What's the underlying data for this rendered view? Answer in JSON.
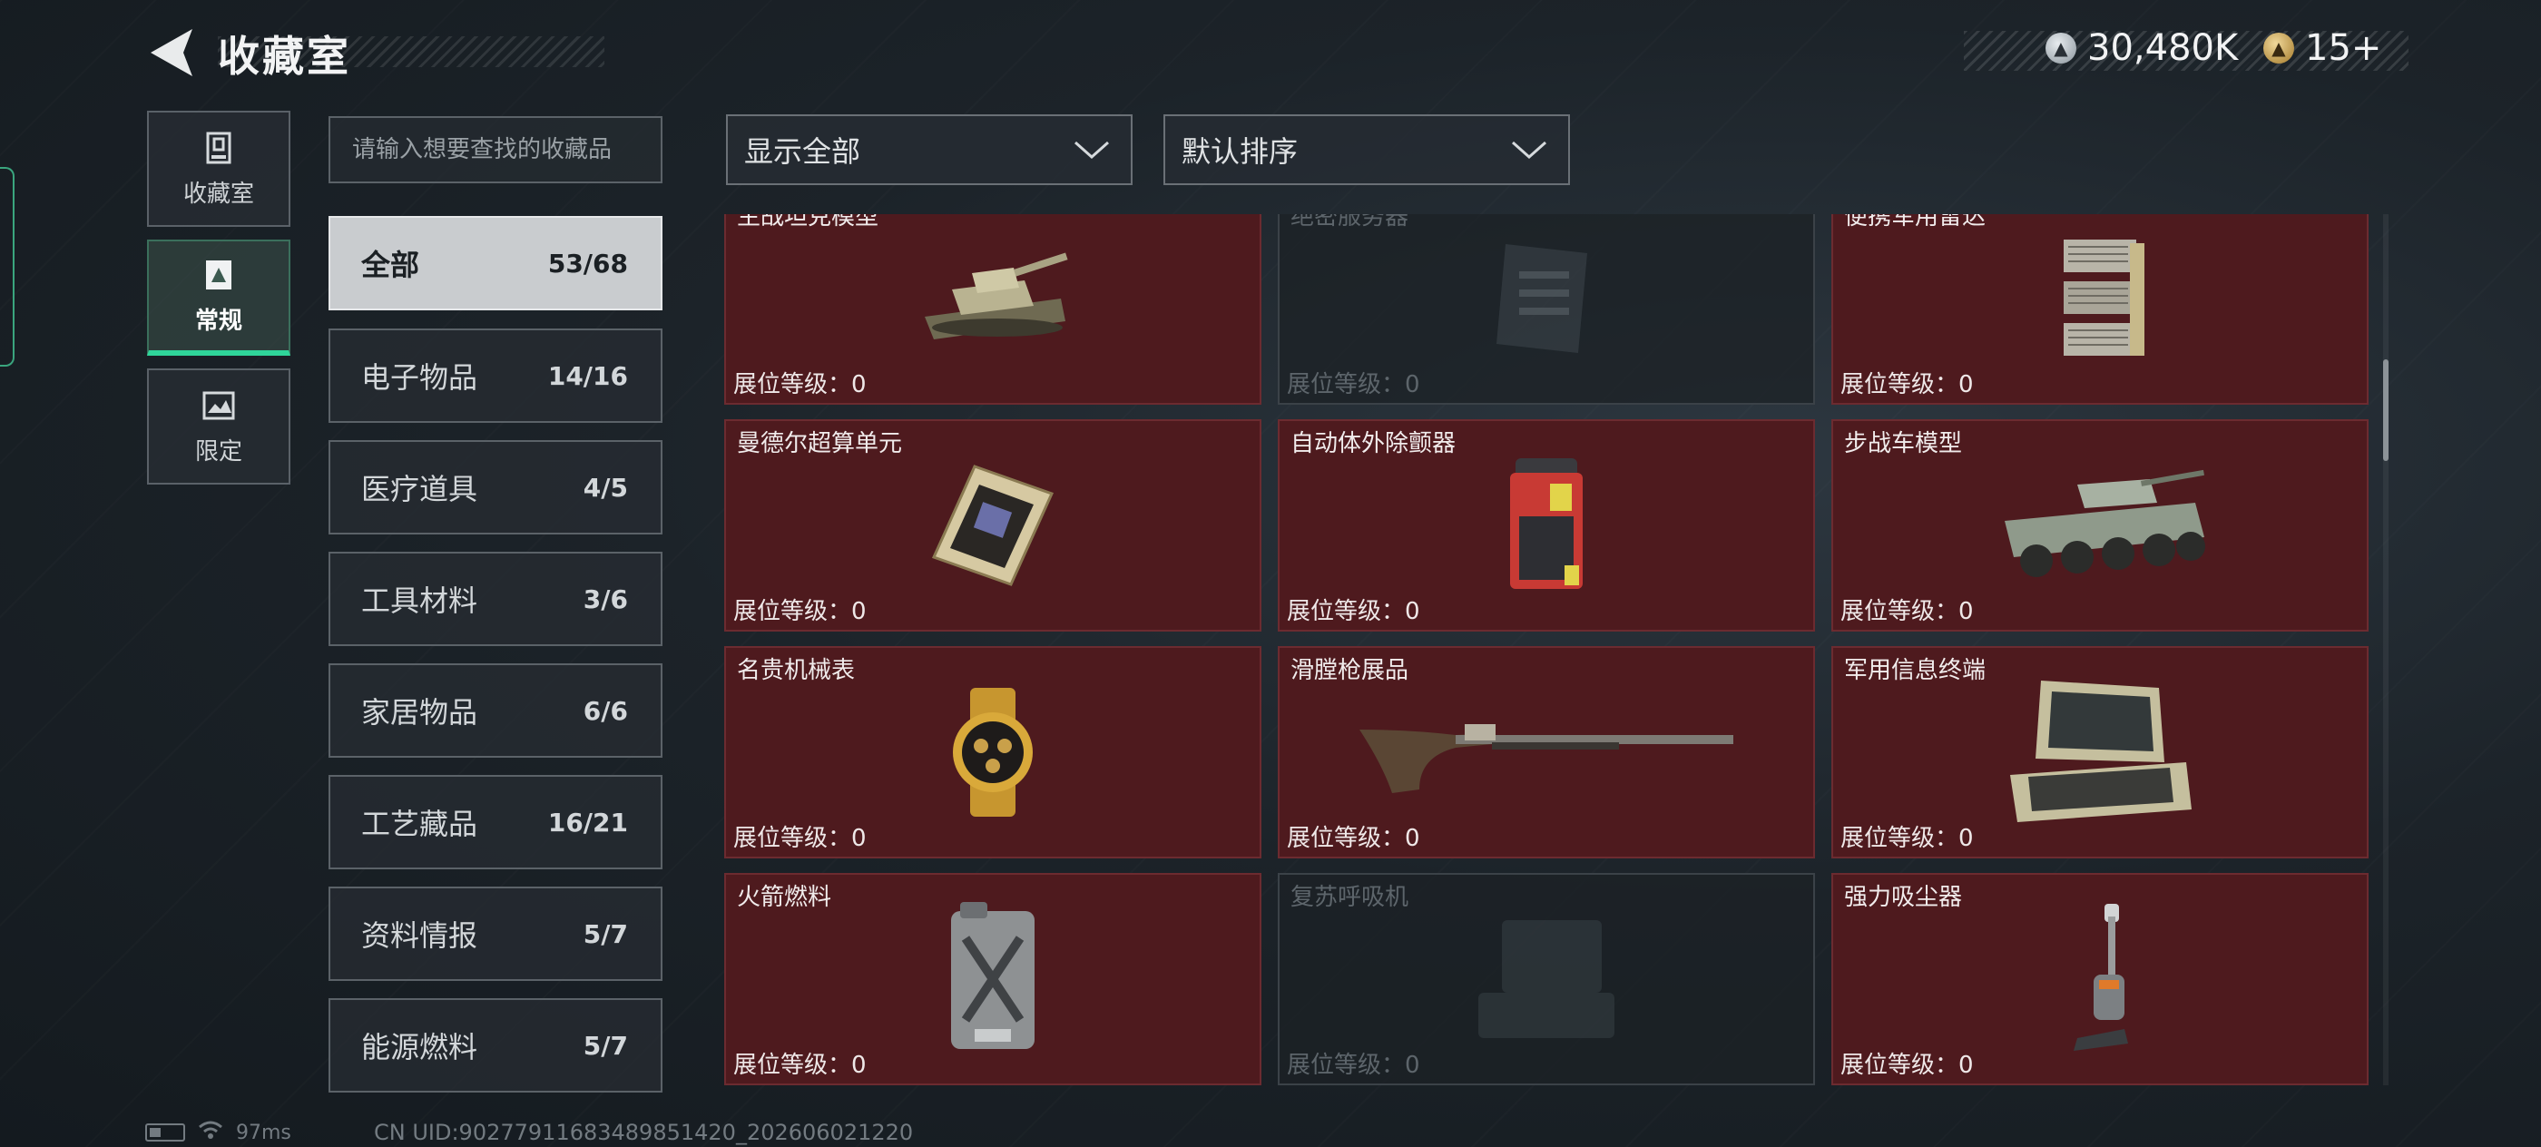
{
  "header": {
    "title": "收藏室",
    "currency_silver": "30,480K",
    "currency_gold": "15+"
  },
  "side_tabs": [
    {
      "label": "收藏室",
      "icon": "collection-room-icon"
    },
    {
      "label": "常规",
      "icon": "regular-card-icon"
    },
    {
      "label": "限定",
      "icon": "limited-image-icon"
    }
  ],
  "search": {
    "placeholder": "请输入想要查找的收藏品"
  },
  "categories": [
    {
      "name": "全部",
      "count": "53/68"
    },
    {
      "name": "电子物品",
      "count": "14/16"
    },
    {
      "name": "医疗道具",
      "count": "4/5"
    },
    {
      "name": "工具材料",
      "count": "3/6"
    },
    {
      "name": "家居物品",
      "count": "6/6"
    },
    {
      "name": "工艺藏品",
      "count": "16/21"
    },
    {
      "name": "资料情报",
      "count": "5/7"
    },
    {
      "name": "能源燃料",
      "count": "5/7"
    }
  ],
  "filters": {
    "display": "显示全部",
    "sort": "默认排序"
  },
  "items": [
    {
      "name": "主战坦克模型",
      "level": "展位等级：0",
      "collected": true,
      "icon": "tank-model-icon"
    },
    {
      "name": "绝密服务器",
      "level": "展位等级：0",
      "collected": false,
      "icon": "server-icon"
    },
    {
      "name": "便携军用雷达",
      "level": "展位等级：0",
      "collected": true,
      "icon": "portable-radar-icon"
    },
    {
      "name": "曼德尔超算单元",
      "level": "展位等级：0",
      "collected": true,
      "icon": "supercomputer-unit-icon"
    },
    {
      "name": "自动体外除颤器",
      "level": "展位等级：0",
      "collected": true,
      "icon": "defibrillator-icon"
    },
    {
      "name": "步战车模型",
      "level": "展位等级：0",
      "collected": true,
      "icon": "ifv-model-icon"
    },
    {
      "name": "名贵机械表",
      "level": "展位等级：0",
      "collected": true,
      "icon": "mechanical-watch-icon"
    },
    {
      "name": "滑膛枪展品",
      "level": "展位等级：0",
      "collected": true,
      "icon": "musket-icon"
    },
    {
      "name": "军用信息终端",
      "level": "展位等级：0",
      "collected": true,
      "icon": "info-terminal-icon"
    },
    {
      "name": "火箭燃料",
      "level": "展位等级：0",
      "collected": true,
      "icon": "rocket-fuel-icon"
    },
    {
      "name": "复苏呼吸机",
      "level": "展位等级：0",
      "collected": false,
      "icon": "ventilator-icon"
    },
    {
      "name": "强力吸尘器",
      "level": "展位等级：0",
      "collected": true,
      "icon": "vacuum-cleaner-icon"
    }
  ],
  "footer": {
    "ping": "97ms",
    "uid": "CN UID:90277911683489851420_202606021220"
  },
  "colors": {
    "card_collected": "#4e1a1e",
    "active_tab_accent": "#2fd59a"
  }
}
